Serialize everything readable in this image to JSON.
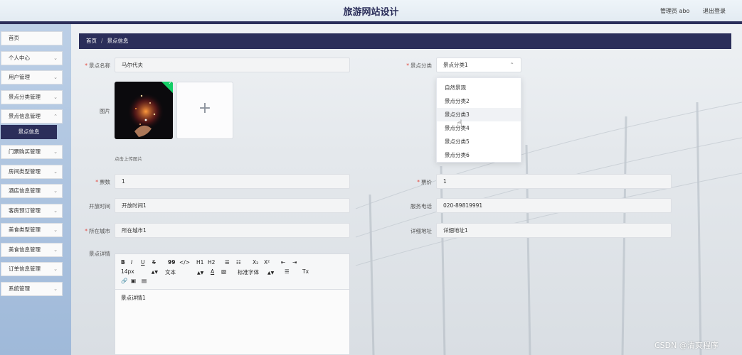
{
  "header": {
    "title": "旅游网站设计",
    "admin": "管理员 abo",
    "logout": "退出登录"
  },
  "sidebar": {
    "items": [
      {
        "label": "首页",
        "chevron": ""
      },
      {
        "label": "个人中心",
        "chevron": "⌄"
      },
      {
        "label": "用户管理",
        "chevron": "⌄"
      },
      {
        "label": "景点分类管理",
        "chevron": "⌄"
      },
      {
        "label": "景点信息管理",
        "chevron": "⌃"
      },
      {
        "label": "门票购买管理",
        "chevron": "⌄"
      },
      {
        "label": "房间类型管理",
        "chevron": "⌄"
      },
      {
        "label": "酒店信息管理",
        "chevron": "⌄"
      },
      {
        "label": "客房预订管理",
        "chevron": "⌄"
      },
      {
        "label": "美食类型管理",
        "chevron": "⌄"
      },
      {
        "label": "美食信息管理",
        "chevron": "⌄"
      },
      {
        "label": "订单信息管理",
        "chevron": "⌄"
      },
      {
        "label": "系统管理",
        "chevron": "⌄"
      }
    ],
    "active_sub": "景点信息"
  },
  "breadcrumb": {
    "home": "首页",
    "separator": "/",
    "current": "景点信息"
  },
  "form": {
    "name_label": "景点名称",
    "name_value": "马尔代夫",
    "category_label": "景点分类",
    "category_value": "景点分类1",
    "image_label": "图片",
    "upload_hint": "点击上传图片",
    "upload_plus": "+",
    "uploaded_check": "✓",
    "tickets_label": "票数",
    "tickets_value": "1",
    "price_label": "票价",
    "price_value": "1",
    "open_label": "开放时间",
    "open_value": "开放时间1",
    "phone_label": "服务电话",
    "phone_value": "020-89819991",
    "city_label": "所在城市",
    "city_value": "所在城市1",
    "address_label": "详细地址",
    "address_value": "详细地址1",
    "details_label": "景点详情",
    "details_value": "景点详情1",
    "required_mark": "*"
  },
  "dropdown": {
    "options": [
      "自然景观",
      "景点分类2",
      "景点分类3",
      "景点分类4",
      "景点分类5",
      "景点分类6"
    ],
    "hovered": "景点分类3"
  },
  "editor_toolbar": {
    "bold": "B",
    "italic": "I",
    "underline": "U",
    "strike": "S",
    "quote": "99",
    "code": "</>",
    "h1": "H1",
    "h2": "H2",
    "ol": "☰",
    "ul": "☷",
    "sub": "X₂",
    "sup": "X²",
    "outdent": "⇤",
    "indent": "⇥",
    "size": "14px",
    "format": "文本",
    "color": "A",
    "background": "▧",
    "font": "标准字体",
    "align": "☰",
    "clear": "Tx",
    "link": "🔗",
    "image": "▣",
    "video": "▤"
  },
  "watermark": "CSDN @清爽程序"
}
